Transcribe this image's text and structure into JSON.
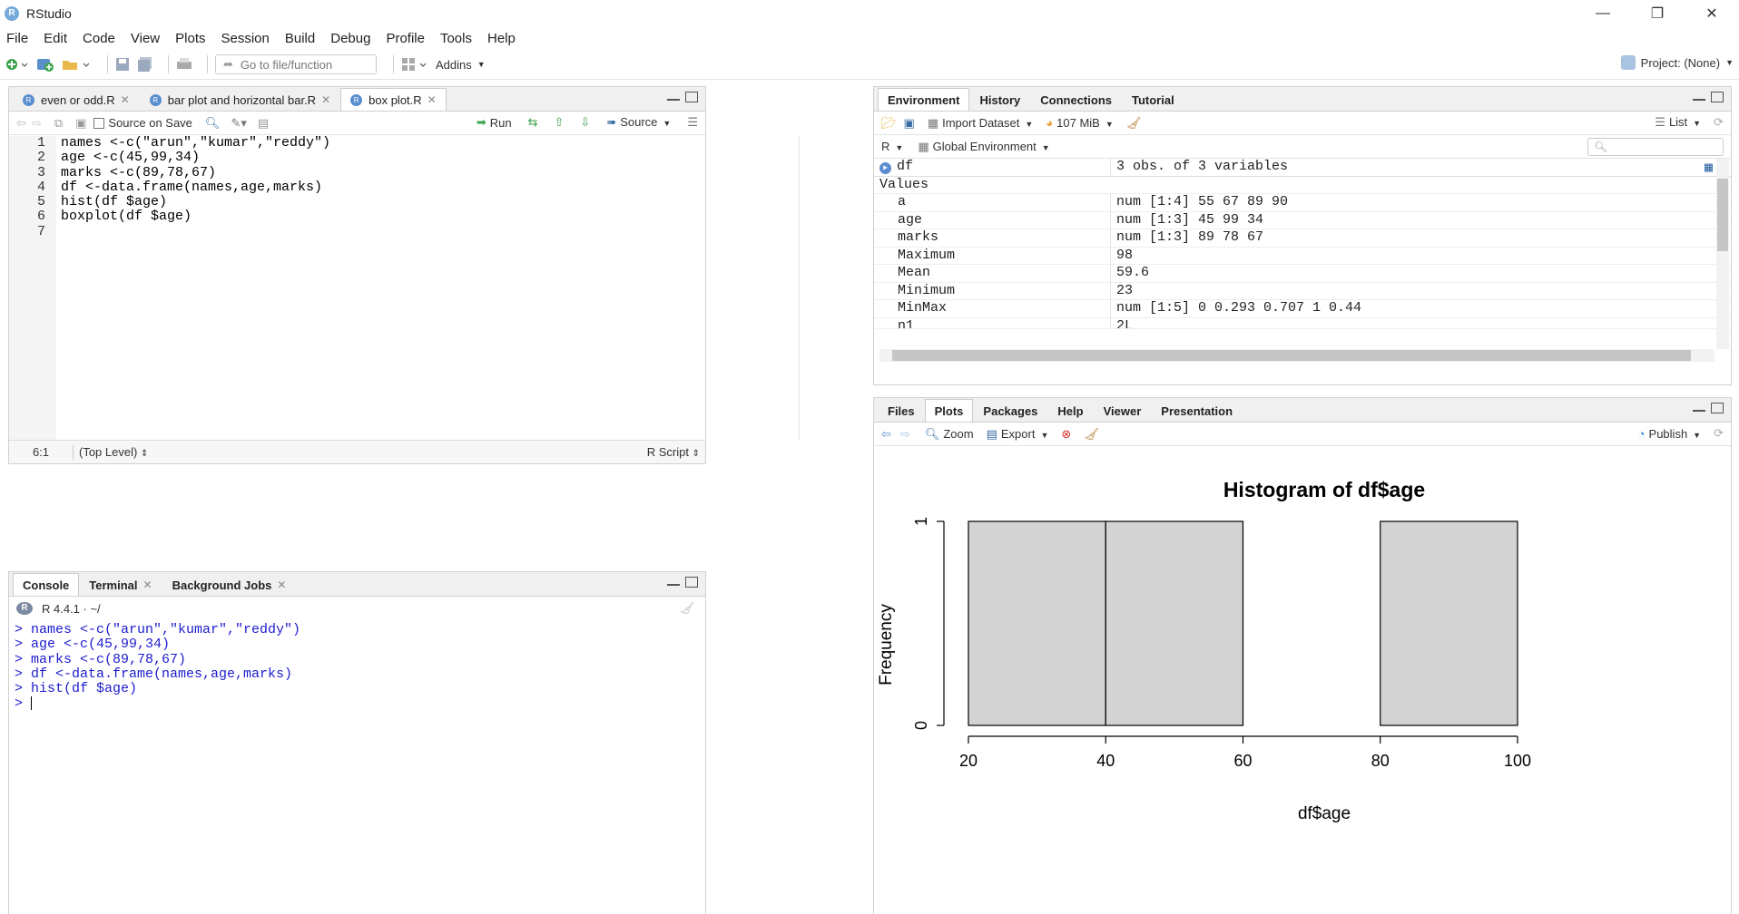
{
  "window": {
    "title": "RStudio",
    "controls": [
      "—",
      "❐",
      "✕"
    ]
  },
  "menu": [
    "File",
    "Edit",
    "Code",
    "View",
    "Plots",
    "Session",
    "Build",
    "Debug",
    "Profile",
    "Tools",
    "Help"
  ],
  "toolbar": {
    "goto_placeholder": "Go to file/function",
    "addins": "Addins",
    "project": "Project: (None)"
  },
  "editor": {
    "tabs": [
      "even or odd.R",
      "bar plot and horizontal bar.R",
      "box plot.R"
    ],
    "active_tab": 2,
    "source_on_save": "Source on Save",
    "run": "Run",
    "source": "Source",
    "lines": [
      "names <-c(\"arun\",\"kumar\",\"reddy\")",
      "age <-c(45,99,34)",
      "marks <-c(89,78,67)",
      "df <-data.frame(names,age,marks)",
      "hist(df $age)",
      "boxplot(df $age)",
      ""
    ],
    "line_numbers": [
      "1",
      "2",
      "3",
      "4",
      "5",
      "6",
      "7"
    ],
    "cursor_pos": "6:1",
    "scope": "(Top Level)",
    "file_type": "R Script"
  },
  "console": {
    "tabs": [
      "Console",
      "Terminal",
      "Background Jobs"
    ],
    "version": "R 4.4.1 · ~/",
    "lines": [
      "> names <-c(\"arun\",\"kumar\",\"reddy\")",
      "> age <-c(45,99,34)",
      "> marks <-c(89,78,67)",
      "> df <-data.frame(names,age,marks)",
      "> hist(df $age)",
      "> "
    ]
  },
  "environment": {
    "tabs": [
      "Environment",
      "History",
      "Connections",
      "Tutorial"
    ],
    "import_dataset": "Import Dataset",
    "memory": "107 MiB",
    "list": "List",
    "lang": "R",
    "scope": "Global Environment",
    "df_name": "df",
    "df_desc": "3 obs. of 3 variables",
    "values_header": "Values",
    "values": [
      {
        "name": "a",
        "value": "num [1:4] 55 67 89 90"
      },
      {
        "name": "age",
        "value": "num [1:3] 45 99 34"
      },
      {
        "name": "marks",
        "value": "num [1:3] 89 78 67"
      },
      {
        "name": "Maximum",
        "value": "98"
      },
      {
        "name": "Mean",
        "value": "59.6"
      },
      {
        "name": "Minimum",
        "value": "23"
      },
      {
        "name": "MinMax",
        "value": "num [1:5] 0 0.293 0.707 1 0.44"
      },
      {
        "name": "n1",
        "value": "2L"
      }
    ]
  },
  "files_pane": {
    "tabs": [
      "Files",
      "Plots",
      "Packages",
      "Help",
      "Viewer",
      "Presentation"
    ],
    "zoom": "Zoom",
    "export": "Export",
    "publish": "Publish"
  },
  "chart_data": {
    "type": "bar",
    "title": "Histogram of df$age",
    "xlabel": "df$age",
    "ylabel": "Frequency",
    "bins": [
      [
        20,
        40
      ],
      [
        40,
        60
      ],
      [
        60,
        80
      ],
      [
        80,
        100
      ]
    ],
    "values": [
      1,
      1,
      0,
      1
    ],
    "xticks": [
      "20",
      "40",
      "60",
      "80",
      "100"
    ],
    "yticks": [
      "0",
      "1"
    ],
    "xlim": [
      20,
      100
    ],
    "ylim": [
      0,
      1
    ],
    "colors": {
      "bar": "#d3d3d3",
      "edge": "#000000"
    }
  }
}
